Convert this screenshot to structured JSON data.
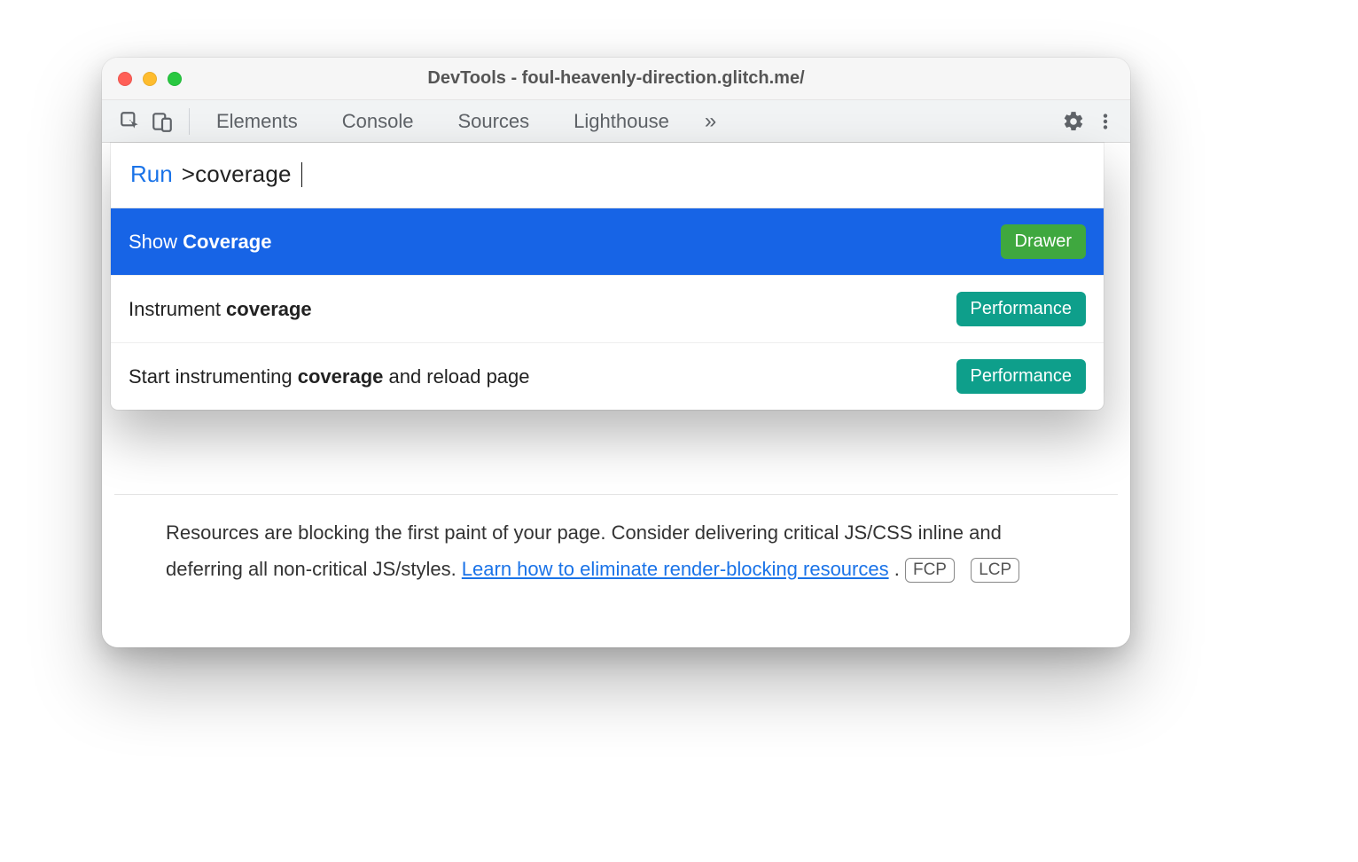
{
  "window": {
    "title": "DevTools - foul-heavenly-direction.glitch.me/"
  },
  "tabs": {
    "items": [
      "Elements",
      "Console",
      "Sources",
      "Lighthouse"
    ],
    "more_glyph": "»"
  },
  "command_menu": {
    "prefix_label": "Run",
    "input_value": ">coverage",
    "items": [
      {
        "text_before": "Show ",
        "match": "Coverage",
        "text_after": "",
        "badge": "Drawer",
        "badge_kind": "drawer",
        "selected": true
      },
      {
        "text_before": "Instrument ",
        "match": "coverage",
        "text_after": "",
        "badge": "Performance",
        "badge_kind": "perf",
        "selected": false
      },
      {
        "text_before": "Start instrumenting ",
        "match": "coverage",
        "text_after": " and reload page",
        "badge": "Performance",
        "badge_kind": "perf",
        "selected": false
      }
    ]
  },
  "body": {
    "paragraph_before_link": "Resources are blocking the first paint of your page. Consider delivering critical JS/CSS inline and deferring all non-critical JS/styles. ",
    "link_text": "Learn how to eliminate render-blocking resources",
    "after_link": ". ",
    "badges": [
      "FCP",
      "LCP"
    ]
  },
  "icons": {
    "gear": "gear-icon",
    "kebab": "kebab-icon",
    "inspect": "inspect-icon",
    "devices": "devices-icon"
  }
}
